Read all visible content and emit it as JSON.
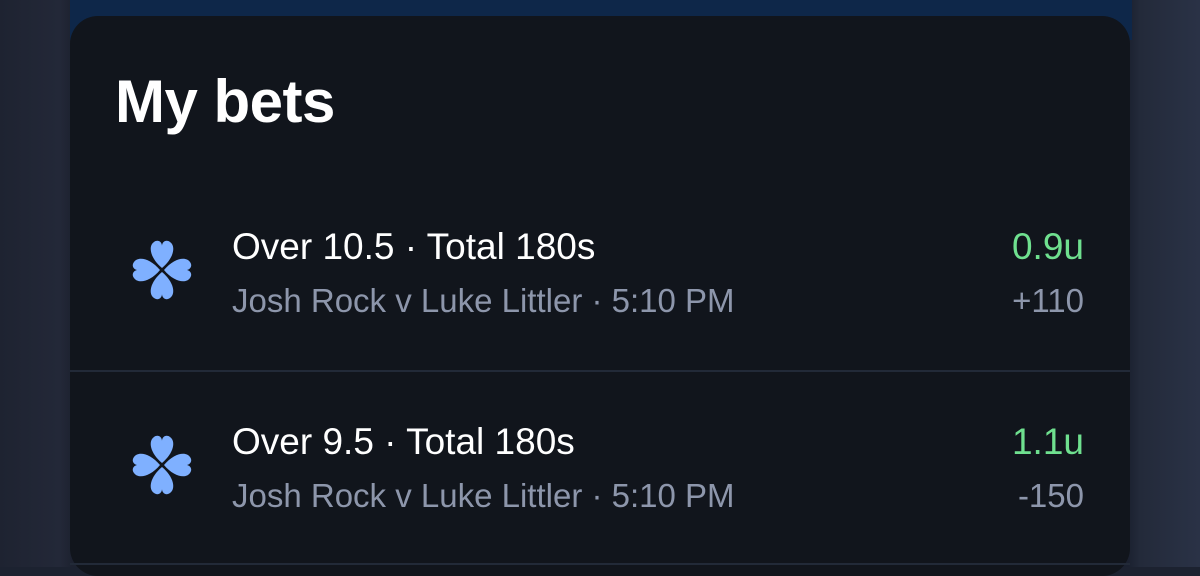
{
  "page": {
    "title": "My bets"
  },
  "colors": {
    "card_background": "#11151c",
    "units_green": "#6fe08f",
    "icon_blue": "#7fb0ff",
    "secondary_text": "#8d96ab"
  },
  "bets": [
    {
      "icon": "clover-icon",
      "title": "Over 10.5 · Total 180s",
      "subtitle": "Josh Rock v Luke Littler · 5:10 PM",
      "units": "0.9u",
      "odds": "+110"
    },
    {
      "icon": "clover-icon",
      "title": "Over 9.5 · Total 180s",
      "subtitle": "Josh Rock v Luke Littler · 5:10 PM",
      "units": "1.1u",
      "odds": "-150"
    }
  ]
}
